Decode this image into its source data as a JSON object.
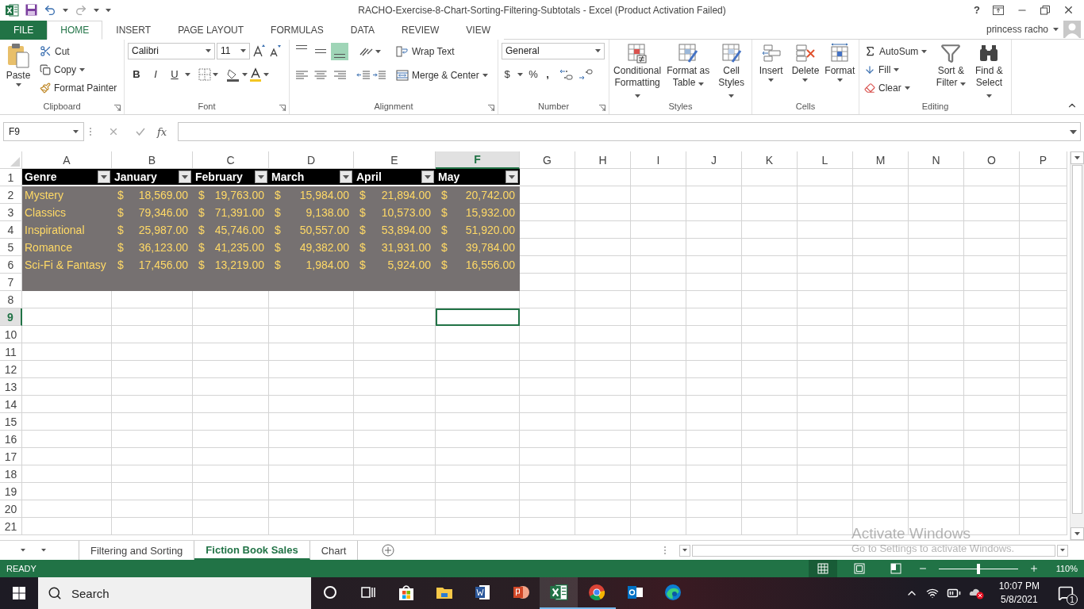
{
  "window": {
    "title": "RACHO-Exercise-8-Chart-Sorting-Filtering-Subtotals - Excel (Product Activation Failed)",
    "help": "?",
    "user": "princess racho"
  },
  "tabs": [
    {
      "label": "FILE",
      "selected": false
    },
    {
      "label": "HOME",
      "selected": true
    },
    {
      "label": "INSERT",
      "selected": false
    },
    {
      "label": "PAGE LAYOUT",
      "selected": false
    },
    {
      "label": "FORMULAS",
      "selected": false
    },
    {
      "label": "DATA",
      "selected": false
    },
    {
      "label": "REVIEW",
      "selected": false
    },
    {
      "label": "VIEW",
      "selected": false
    }
  ],
  "ribbon": {
    "clipboard": {
      "paste": "Paste",
      "cut": "Cut",
      "copy": "Copy",
      "format_painter": "Format Painter",
      "label": "Clipboard"
    },
    "font": {
      "name": "Calibri",
      "size": "11",
      "bold": "B",
      "italic": "I",
      "underline": "U",
      "label": "Font"
    },
    "alignment": {
      "vertical_align": [
        {
          "selected": false
        },
        {
          "selected": false
        },
        {
          "selected": true
        }
      ],
      "wrap_text": "Wrap Text",
      "merge": "Merge & Center",
      "label": "Alignment"
    },
    "number": {
      "format": "General",
      "currency": "$",
      "percent": "%",
      "comma": ",",
      "label": "Number"
    },
    "styles": {
      "buttons": [
        {
          "label": "Conditional Formatting"
        },
        {
          "label": "Format as Table"
        },
        {
          "label": "Cell Styles"
        }
      ],
      "label": "Styles"
    },
    "cells": {
      "buttons": [
        {
          "label": "Insert"
        },
        {
          "label": "Delete"
        },
        {
          "label": "Format"
        }
      ],
      "label": "Cells"
    },
    "editing": {
      "autosum": "AutoSum",
      "fill": "Fill",
      "clear": "Clear",
      "sort": "Sort & Filter",
      "find": "Find & Select",
      "label": "Editing"
    }
  },
  "formula_bar": {
    "name_box": "F9",
    "fx": "fx"
  },
  "columns": [
    {
      "label": "A",
      "selected": false
    },
    {
      "label": "B",
      "selected": false
    },
    {
      "label": "C",
      "selected": false
    },
    {
      "label": "D",
      "selected": false
    },
    {
      "label": "E",
      "selected": false
    },
    {
      "label": "F",
      "selected": true
    },
    {
      "label": "G",
      "selected": false
    },
    {
      "label": "H",
      "selected": false
    },
    {
      "label": "I",
      "selected": false
    },
    {
      "label": "J",
      "selected": false
    },
    {
      "label": "K",
      "selected": false
    },
    {
      "label": "L",
      "selected": false
    },
    {
      "label": "M",
      "selected": false
    },
    {
      "label": "N",
      "selected": false
    },
    {
      "label": "O",
      "selected": false
    },
    {
      "label": "P",
      "selected": false
    }
  ],
  "row_numbers": [
    {
      "label": "1",
      "selected": false
    },
    {
      "label": "2",
      "selected": false
    },
    {
      "label": "3",
      "selected": false
    },
    {
      "label": "4",
      "selected": false
    },
    {
      "label": "5",
      "selected": false
    },
    {
      "label": "6",
      "selected": false
    },
    {
      "label": "7",
      "selected": false
    },
    {
      "label": "8",
      "selected": false
    },
    {
      "label": "9",
      "selected": true
    },
    {
      "label": "10",
      "selected": false
    },
    {
      "label": "11",
      "selected": false
    },
    {
      "label": "12",
      "selected": false
    },
    {
      "label": "13",
      "selected": false
    },
    {
      "label": "14",
      "selected": false
    },
    {
      "label": "15",
      "selected": false
    },
    {
      "label": "16",
      "selected": false
    },
    {
      "label": "17",
      "selected": false
    },
    {
      "label": "18",
      "selected": false
    },
    {
      "label": "19",
      "selected": false
    },
    {
      "label": "20",
      "selected": false
    },
    {
      "label": "21",
      "selected": false
    }
  ],
  "table": {
    "columns": [
      "Genre",
      "January",
      "February",
      "March",
      "April",
      "May"
    ],
    "rows": [
      {
        "genre": "Mystery",
        "values": [
          {
            "currency": "$",
            "amount": "18,569.00"
          },
          {
            "currency": "$",
            "amount": "19,763.00"
          },
          {
            "currency": "$",
            "amount": "15,984.00"
          },
          {
            "currency": "$",
            "amount": "21,894.00"
          },
          {
            "currency": "$",
            "amount": "20,742.00"
          }
        ]
      },
      {
        "genre": "Classics",
        "values": [
          {
            "currency": "$",
            "amount": "79,346.00"
          },
          {
            "currency": "$",
            "amount": "71,391.00"
          },
          {
            "currency": "$",
            "amount": "9,138.00"
          },
          {
            "currency": "$",
            "amount": "10,573.00"
          },
          {
            "currency": "$",
            "amount": "15,932.00"
          }
        ]
      },
      {
        "genre": "Inspirational",
        "values": [
          {
            "currency": "$",
            "amount": "25,987.00"
          },
          {
            "currency": "$",
            "amount": "45,746.00"
          },
          {
            "currency": "$",
            "amount": "50,557.00"
          },
          {
            "currency": "$",
            "amount": "53,894.00"
          },
          {
            "currency": "$",
            "amount": "51,920.00"
          }
        ]
      },
      {
        "genre": "Romance",
        "values": [
          {
            "currency": "$",
            "amount": "36,123.00"
          },
          {
            "currency": "$",
            "amount": "41,235.00"
          },
          {
            "currency": "$",
            "amount": "49,382.00"
          },
          {
            "currency": "$",
            "amount": "31,931.00"
          },
          {
            "currency": "$",
            "amount": "39,784.00"
          }
        ]
      },
      {
        "genre": "Sci-Fi & Fantasy",
        "values": [
          {
            "currency": "$",
            "amount": "17,456.00"
          },
          {
            "currency": "$",
            "amount": "13,219.00"
          },
          {
            "currency": "$",
            "amount": "1,984.00"
          },
          {
            "currency": "$",
            "amount": "5,924.00"
          },
          {
            "currency": "$",
            "amount": "16,556.00"
          }
        ]
      }
    ]
  },
  "sheet_tabs": [
    {
      "label": "Filtering and Sorting",
      "selected": false
    },
    {
      "label": "Fiction Book Sales",
      "selected": true
    },
    {
      "label": "Chart",
      "selected": false
    }
  ],
  "activation_notice": {
    "title": "Activate Windows",
    "text": "Go to Settings to activate Windows."
  },
  "status_bar": {
    "status": "READY",
    "views": [
      {
        "selected": true
      },
      {
        "selected": false
      },
      {
        "selected": false
      }
    ],
    "zoom": {
      "level": 0.5
    },
    "zoom_reading": "110%"
  },
  "taskbar": {
    "search": {
      "placeholder": "Search"
    },
    "time": "10:07 PM",
    "date": "5/8/2021",
    "notifications": "1"
  }
}
